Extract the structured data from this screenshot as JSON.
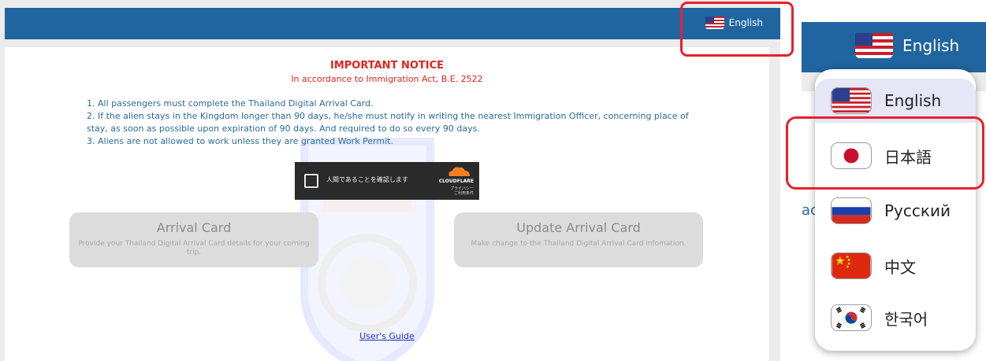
{
  "top_bar": {
    "language_label": "English"
  },
  "notice": {
    "title": "IMPORTANT NOTICE",
    "subtitle": "In accordance to Immigration Act, B.E. 2522",
    "rules": [
      "1. All passengers must complete the Thailand Digital Arrival Card.",
      "2. If the alien stays in the Kingdom longer than 90 days, he/she must notify in writing the nearest Immigration Officer, concerning place of stay, as soon as possible upon expiration of 90 days. And required to do so every 90 days.",
      "3. Aliens are not allowed to work unless they are granted Work Permit."
    ]
  },
  "captcha": {
    "checkbox_label": "人間であることを確認します",
    "brand": "CLOUDFLARE",
    "links": [
      "プライバシー",
      "ご利用条件"
    ]
  },
  "tiles": {
    "arrival": {
      "title": "Arrival Card",
      "description": "Provide your Thailand Digital Arrival Card details for your coming trip."
    },
    "update": {
      "title": "Update Arrival Card",
      "description": "Make change to the Thailand Digital Arrival Card infomation."
    }
  },
  "guide_link": "User's Guide",
  "zoom_panel": {
    "language_label": "English",
    "peek_text": "ac",
    "languages": [
      {
        "label": "English",
        "flag": "us-flag",
        "active": true
      },
      {
        "label": "日本語",
        "flag": "jp-flag",
        "active": false
      },
      {
        "label": "Русский",
        "flag": "ru-flag",
        "active": false
      },
      {
        "label": "中文",
        "flag": "cn-flag",
        "active": false
      },
      {
        "label": "한국어",
        "flag": "kr-flag",
        "active": false
      }
    ]
  },
  "colors": {
    "top_bar": "#2065a0",
    "notice_red": "#e4231d",
    "rules_blue": "#2a6a9c",
    "highlight": "#e8202a"
  }
}
